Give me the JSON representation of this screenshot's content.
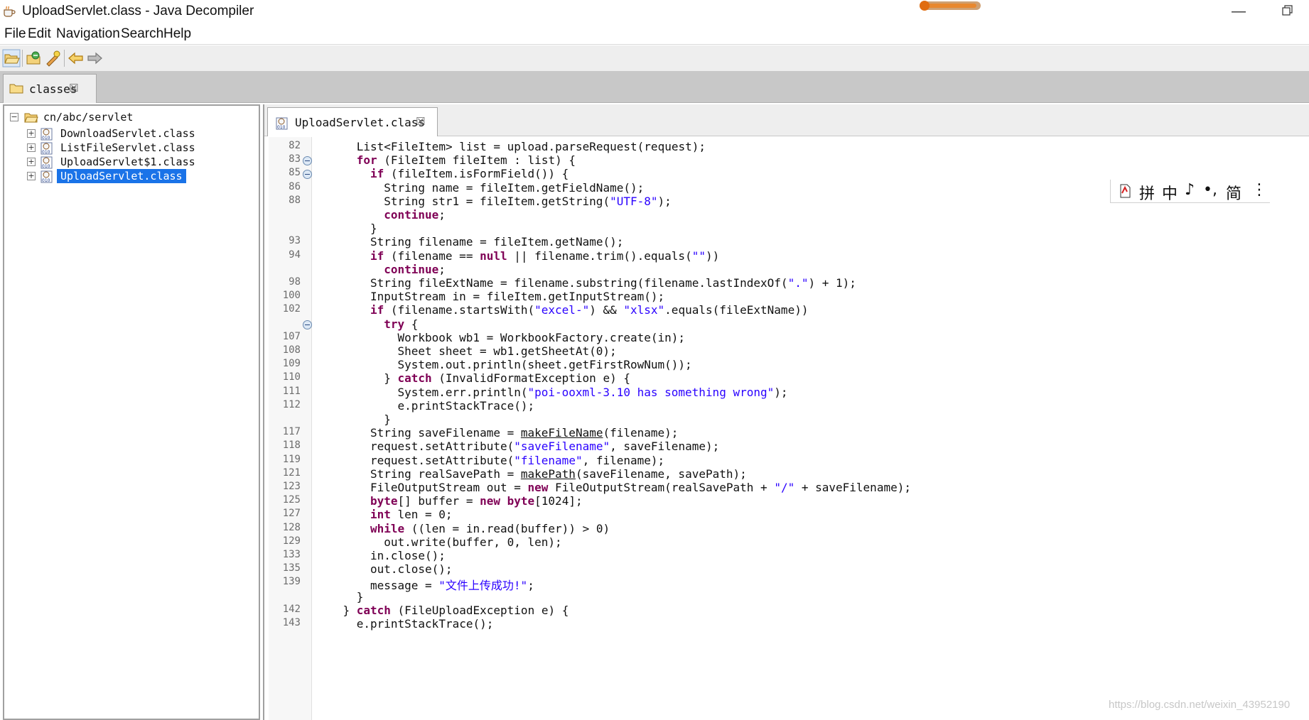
{
  "window": {
    "title": "UploadServlet.class - Java Decompiler",
    "minimize_glyph": "—"
  },
  "menu": [
    "File",
    "Edit",
    "Navigation",
    "Search",
    "Help"
  ],
  "toolbar": {
    "buttons": [
      "open-file-icon",
      "open-type-icon",
      "open-type-hierarchy-icon",
      "back-icon",
      "forward-icon"
    ]
  },
  "outer_tab": {
    "label": "classes",
    "close": "☒"
  },
  "tree": {
    "root": "cn/abc/servlet",
    "items": [
      {
        "label": "DownloadServlet.class",
        "selected": false
      },
      {
        "label": "ListFileServlet.class",
        "selected": false
      },
      {
        "label": "UploadServlet$1.class",
        "selected": false
      },
      {
        "label": "UploadServlet.class",
        "selected": true
      }
    ]
  },
  "editor_tab": {
    "label": "UploadServlet.class",
    "close": "☒"
  },
  "code": {
    "lines": [
      {
        "ln": "82",
        "fold": false,
        "indent": 6,
        "tokens": [
          [
            "t",
            "List<FileItem> list = upload.parseRequest(request);"
          ]
        ]
      },
      {
        "ln": "83",
        "fold": true,
        "indent": 6,
        "tokens": [
          [
            "k",
            "for"
          ],
          [
            "t",
            " (FileItem fileItem : list) {"
          ]
        ]
      },
      {
        "ln": "85",
        "fold": true,
        "indent": 8,
        "tokens": [
          [
            "k",
            "if"
          ],
          [
            "t",
            " (fileItem.isFormField()) {"
          ]
        ]
      },
      {
        "ln": "86",
        "fold": false,
        "indent": 10,
        "tokens": [
          [
            "t",
            "String name = fileItem.getFieldName();"
          ]
        ]
      },
      {
        "ln": "88",
        "fold": false,
        "indent": 10,
        "tokens": [
          [
            "t",
            "String str1 = fileItem.getString("
          ],
          [
            "s",
            "\"UTF-8\""
          ],
          [
            "t",
            ");"
          ]
        ]
      },
      {
        "ln": "",
        "fold": false,
        "indent": 10,
        "tokens": [
          [
            "k",
            "continue"
          ],
          [
            "t",
            ";"
          ]
        ]
      },
      {
        "ln": "",
        "fold": false,
        "indent": 8,
        "tokens": [
          [
            "t",
            "}"
          ]
        ]
      },
      {
        "ln": "93",
        "fold": false,
        "indent": 8,
        "tokens": [
          [
            "t",
            "String filename = fileItem.getName();"
          ]
        ]
      },
      {
        "ln": "94",
        "fold": false,
        "indent": 8,
        "tokens": [
          [
            "k",
            "if"
          ],
          [
            "t",
            " (filename == "
          ],
          [
            "k",
            "null"
          ],
          [
            "t",
            " || filename.trim().equals("
          ],
          [
            "s",
            "\"\""
          ],
          [
            "t",
            "))"
          ]
        ]
      },
      {
        "ln": "",
        "fold": false,
        "indent": 10,
        "tokens": [
          [
            "k",
            "continue"
          ],
          [
            "t",
            ";"
          ]
        ]
      },
      {
        "ln": "98",
        "fold": false,
        "indent": 8,
        "tokens": [
          [
            "t",
            "String fileExtName = filename.substring(filename.lastIndexOf("
          ],
          [
            "s",
            "\".\""
          ],
          [
            "t",
            ") + 1);"
          ]
        ]
      },
      {
        "ln": "100",
        "fold": false,
        "indent": 8,
        "tokens": [
          [
            "t",
            "InputStream in = fileItem.getInputStream();"
          ]
        ]
      },
      {
        "ln": "102",
        "fold": false,
        "indent": 8,
        "tokens": [
          [
            "k",
            "if"
          ],
          [
            "t",
            " (filename.startsWith("
          ],
          [
            "s",
            "\"excel-\""
          ],
          [
            "t",
            ") && "
          ],
          [
            "s",
            "\"xlsx\""
          ],
          [
            "t",
            ".equals(fileExtName))"
          ]
        ]
      },
      {
        "ln": "",
        "fold": true,
        "indent": 10,
        "tokens": [
          [
            "k",
            "try"
          ],
          [
            "t",
            " {"
          ]
        ]
      },
      {
        "ln": "107",
        "fold": false,
        "indent": 12,
        "tokens": [
          [
            "t",
            "Workbook wb1 = WorkbookFactory.create(in);"
          ]
        ]
      },
      {
        "ln": "108",
        "fold": false,
        "indent": 12,
        "tokens": [
          [
            "t",
            "Sheet sheet = wb1.getSheetAt(0);"
          ]
        ]
      },
      {
        "ln": "109",
        "fold": false,
        "indent": 12,
        "tokens": [
          [
            "t",
            "System.out.println(sheet.getFirstRowNum());"
          ]
        ]
      },
      {
        "ln": "110",
        "fold": false,
        "indent": 10,
        "tokens": [
          [
            "t",
            "} "
          ],
          [
            "k",
            "catch"
          ],
          [
            "t",
            " (InvalidFormatException e) {"
          ]
        ]
      },
      {
        "ln": "111",
        "fold": false,
        "indent": 12,
        "tokens": [
          [
            "t",
            "System.err.println("
          ],
          [
            "s",
            "\"poi-ooxml-3.10 has something wrong\""
          ],
          [
            "t",
            ");"
          ]
        ]
      },
      {
        "ln": "112",
        "fold": false,
        "indent": 12,
        "tokens": [
          [
            "t",
            "e.printStackTrace();"
          ]
        ]
      },
      {
        "ln": "",
        "fold": false,
        "indent": 10,
        "tokens": [
          [
            "t",
            "}"
          ]
        ]
      },
      {
        "ln": "117",
        "fold": false,
        "indent": 8,
        "tokens": [
          [
            "t",
            "String saveFilename = "
          ],
          [
            "m",
            "makeFileName"
          ],
          [
            "t",
            "(filename);"
          ]
        ]
      },
      {
        "ln": "118",
        "fold": false,
        "indent": 8,
        "tokens": [
          [
            "t",
            "request.setAttribute("
          ],
          [
            "s",
            "\"saveFilename\""
          ],
          [
            "t",
            ", saveFilename);"
          ]
        ]
      },
      {
        "ln": "119",
        "fold": false,
        "indent": 8,
        "tokens": [
          [
            "t",
            "request.setAttribute("
          ],
          [
            "s",
            "\"filename\""
          ],
          [
            "t",
            ", filename);"
          ]
        ]
      },
      {
        "ln": "121",
        "fold": false,
        "indent": 8,
        "tokens": [
          [
            "t",
            "String realSavePath = "
          ],
          [
            "m",
            "makePath"
          ],
          [
            "t",
            "(saveFilename, savePath);"
          ]
        ]
      },
      {
        "ln": "123",
        "fold": false,
        "indent": 8,
        "tokens": [
          [
            "t",
            "FileOutputStream out = "
          ],
          [
            "k",
            "new"
          ],
          [
            "t",
            " FileOutputStream(realSavePath + "
          ],
          [
            "s",
            "\"/\""
          ],
          [
            "t",
            " + saveFilename);"
          ]
        ]
      },
      {
        "ln": "125",
        "fold": false,
        "indent": 8,
        "tokens": [
          [
            "k",
            "byte"
          ],
          [
            "t",
            "[] buffer = "
          ],
          [
            "k",
            "new"
          ],
          [
            "t",
            " "
          ],
          [
            "k",
            "byte"
          ],
          [
            "t",
            "[1024];"
          ]
        ]
      },
      {
        "ln": "127",
        "fold": false,
        "indent": 8,
        "tokens": [
          [
            "k",
            "int"
          ],
          [
            "t",
            " len = 0;"
          ]
        ]
      },
      {
        "ln": "128",
        "fold": false,
        "indent": 8,
        "tokens": [
          [
            "k",
            "while"
          ],
          [
            "t",
            " ((len = in.read(buffer)) > 0)"
          ]
        ]
      },
      {
        "ln": "129",
        "fold": false,
        "indent": 10,
        "tokens": [
          [
            "t",
            "out.write(buffer, 0, len);"
          ]
        ]
      },
      {
        "ln": "133",
        "fold": false,
        "indent": 8,
        "tokens": [
          [
            "t",
            "in.close();"
          ]
        ]
      },
      {
        "ln": "135",
        "fold": false,
        "indent": 8,
        "tokens": [
          [
            "t",
            "out.close();"
          ]
        ]
      },
      {
        "ln": "139",
        "fold": false,
        "indent": 8,
        "tokens": [
          [
            "t",
            "message = "
          ],
          [
            "s",
            "\"文件上传成功!\""
          ],
          [
            "t",
            ";"
          ]
        ]
      },
      {
        "ln": "",
        "fold": false,
        "indent": 6,
        "tokens": [
          [
            "t",
            "}"
          ]
        ]
      },
      {
        "ln": "142",
        "fold": false,
        "indent": 4,
        "tokens": [
          [
            "t",
            "} "
          ],
          [
            "k",
            "catch"
          ],
          [
            "t",
            " (FileUploadException e) {"
          ]
        ]
      },
      {
        "ln": "143",
        "fold": false,
        "indent": 6,
        "tokens": [
          [
            "t",
            "e.printStackTrace();"
          ]
        ]
      }
    ]
  },
  "ime_bar": {
    "items": [
      "拼",
      "中",
      "♪",
      "•,",
      "简",
      "⋮"
    ]
  },
  "watermark": "https://blog.csdn.net/weixin_43952190"
}
